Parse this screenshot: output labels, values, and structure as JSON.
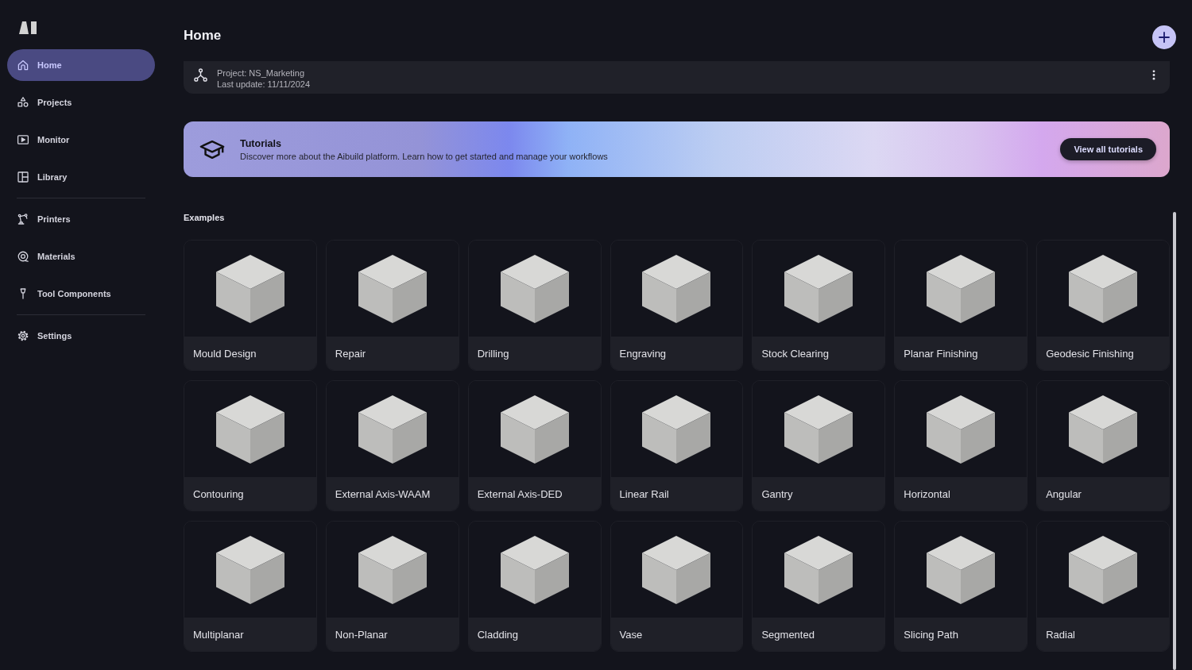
{
  "sidebar": {
    "groups": [
      [
        {
          "label": "Home",
          "selected": true
        },
        {
          "label": "Projects",
          "selected": false
        },
        {
          "label": "Monitor",
          "selected": false
        },
        {
          "label": "Library",
          "selected": false
        }
      ],
      [
        {
          "label": "Printers",
          "selected": false
        },
        {
          "label": "Materials",
          "selected": false
        },
        {
          "label": "Tool Components",
          "selected": false
        }
      ],
      [
        {
          "label": "Settings",
          "selected": false
        }
      ]
    ]
  },
  "header": {
    "title": "Home"
  },
  "recent_project": {
    "project": "Project: NS_Marketing",
    "updated": "Last update: 11/11/2024"
  },
  "tutorials": {
    "title": "Tutorials",
    "description": "Discover more about the Aibuild platform. Learn how to get started and manage your workflows",
    "button": "View all tutorials"
  },
  "examples": {
    "heading": "Examples",
    "items": [
      "Mould Design",
      "Repair",
      "Drilling",
      "Engraving",
      "Stock Clearing",
      "Planar Finishing",
      "Geodesic Finishing",
      "Contouring",
      "External Axis-WAAM",
      "External Axis-DED",
      "Linear Rail",
      "Gantry",
      "Horizontal",
      "Angular",
      "Multiplanar",
      "Non-Planar",
      "Cladding",
      "Vase",
      "Segmented",
      "Slicing Path",
      "Radial"
    ]
  }
}
